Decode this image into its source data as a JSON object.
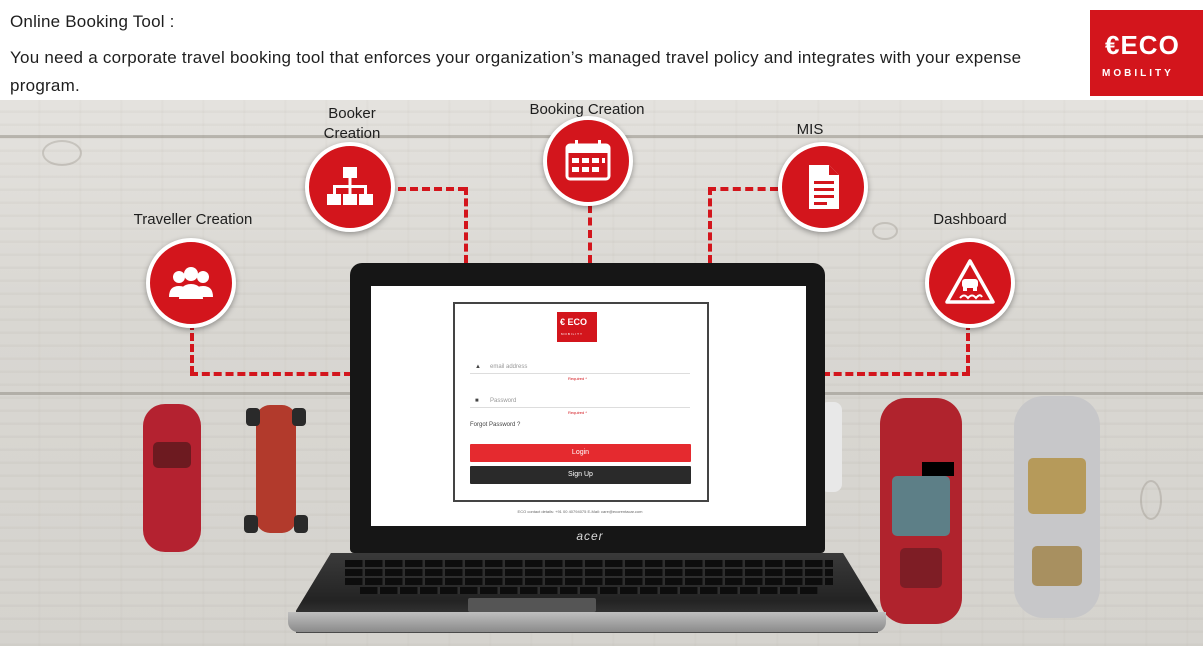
{
  "header": {
    "title": "Online Booking Tool :",
    "description": "You need a corporate travel booking tool that enforces your organization’s managed travel policy and integrates with your expense program."
  },
  "brand": {
    "word": "ECO",
    "arrow": "€",
    "sub": "MOBILITY",
    "color": "#d3151c"
  },
  "features": [
    {
      "label": "Traveller Creation",
      "icon": "users-group-icon"
    },
    {
      "label": "Booker\nCreation",
      "icon": "org-chart-icon"
    },
    {
      "label": "Booking Creation",
      "icon": "calendar-icon"
    },
    {
      "label": "MIS",
      "icon": "document-icon"
    },
    {
      "label": "Dashboard",
      "icon": "road-warning-icon"
    }
  ],
  "login": {
    "logo_word": "€ ECO",
    "logo_sub": "MOBILITY",
    "email_placeholder": "email address",
    "email_required": "Required *",
    "password_placeholder": "Password",
    "password_required": "Required *",
    "forgot": "Forgot Password ?",
    "login_button": "Login",
    "signup_button": "Sign Up",
    "contact": "ECO contact details: +91 00 40794075  E-Mail: care@ecorentacar.com"
  },
  "laptop_brand": "acer",
  "accent_color": "#d3151c"
}
